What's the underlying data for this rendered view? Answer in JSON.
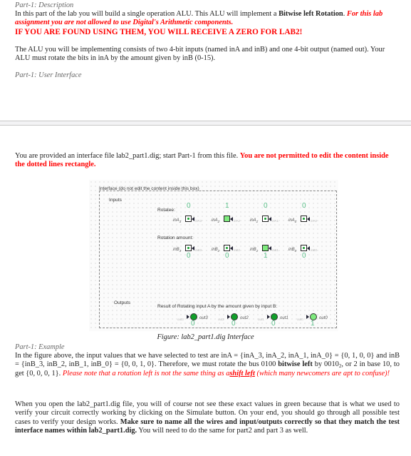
{
  "description": {
    "heading": "Part-1: Description",
    "intro": "In this part of the lab you will build a single operation ALU. This ALU will implement a ",
    "intro_bold": "Bitwise left Rotation",
    "intro_end": ". ",
    "warning_italic": "For this lab assignment you are not allowed to use Digital's Arithmetic components.",
    "warning_caps": "IF YOU ARE FOUND USING THEM, YOU WILL RECEIVE A ZERO FOR LAB2!",
    "para2": "The ALU you will be implementing consists of two 4-bit inputs (named inA and inB) and one 4-bit output (named out). Your ALU must rotate the bits in inA by the amount given by inB (0-15)."
  },
  "user_interface": {
    "heading": "Part-1: User Interface",
    "provided_text": "You are provided an interface file lab2_part1.dig; start Part-1 from this file. ",
    "provided_warning": "You are not permitted to edit the content inside the dotted lines rectangle."
  },
  "circuit": {
    "box_title": "Interface (do not edit the content inside this box)",
    "inputs_label": "Inputs",
    "outputs_label": "Outputs",
    "rotatee_label": "Rotatee:",
    "rotation_amount_label": "Rotation amount:",
    "result_label": "Result of Rotating input A by the amount given by input B:",
    "inA": [
      {
        "name": "inA",
        "sub": "3",
        "value": "0",
        "on": false
      },
      {
        "name": "inA",
        "sub": "2",
        "value": "1",
        "on": true
      },
      {
        "name": "inA",
        "sub": "1",
        "value": "0",
        "on": false
      },
      {
        "name": "inA",
        "sub": "0",
        "value": "0",
        "on": false
      }
    ],
    "inB": [
      {
        "name": "inB",
        "sub": "3",
        "value": "0",
        "on": false
      },
      {
        "name": "inB",
        "sub": "2",
        "value": "0",
        "on": false
      },
      {
        "name": "inB",
        "sub": "1",
        "value": "1",
        "on": true
      },
      {
        "name": "inB",
        "sub": "0",
        "value": "0",
        "on": false
      }
    ],
    "outputs": [
      {
        "name": "out3",
        "value": "0",
        "on": false
      },
      {
        "name": "out2",
        "value": "0",
        "on": false
      },
      {
        "name": "out1",
        "value": "0",
        "on": false
      },
      {
        "name": "out0",
        "value": "1",
        "on": true
      }
    ],
    "value_color": "#5cc08a",
    "on_color": "#7eea7e",
    "off_dot_color": "#119f2a"
  },
  "figure_caption": "Figure: lab2_part1.dig Interface",
  "example": {
    "heading": "Part-1: Example",
    "text1": "In the figure above, the input values that we have selected to test are inA = {inA_3, inA_2, inA_1, inA_0} = {0, 1, 0, 0} and inB = {inB_3, inB_2, inB_1, inB_0} = {0, 0, 1, 0}. Therefore, we must rotate the bus 0100 ",
    "text1_bold": "bitwise left",
    "text1_b": " by 0010",
    "text1_sub": "2",
    "text1_c": ", or 2 in base 10, to get {0, 0, 0, 1}. ",
    "note_a": "Please note that a rotation left is not the same thing as a",
    "note_link": "shift left",
    "note_b": " (which many newcomers are apt to confuse)!"
  },
  "closing": {
    "text_a": "When you open the lab2_part1.dig file, you will of course not see these exact values in green because that is what we used to verify your circuit correctly working by clicking on the Simulate button. On your end, you should go through all possible test cases to verify your design works. ",
    "text_bold": "Make sure to name all the wires and input/outputs correctly so that they match the test interface names within lab2_part1.dig.",
    "text_b": " You will need to do the same for part2 and part 3 as well."
  },
  "colors": {
    "warning_red": "#ff0000",
    "heading_gray": "#666666",
    "divider": "#c8c8c8"
  }
}
